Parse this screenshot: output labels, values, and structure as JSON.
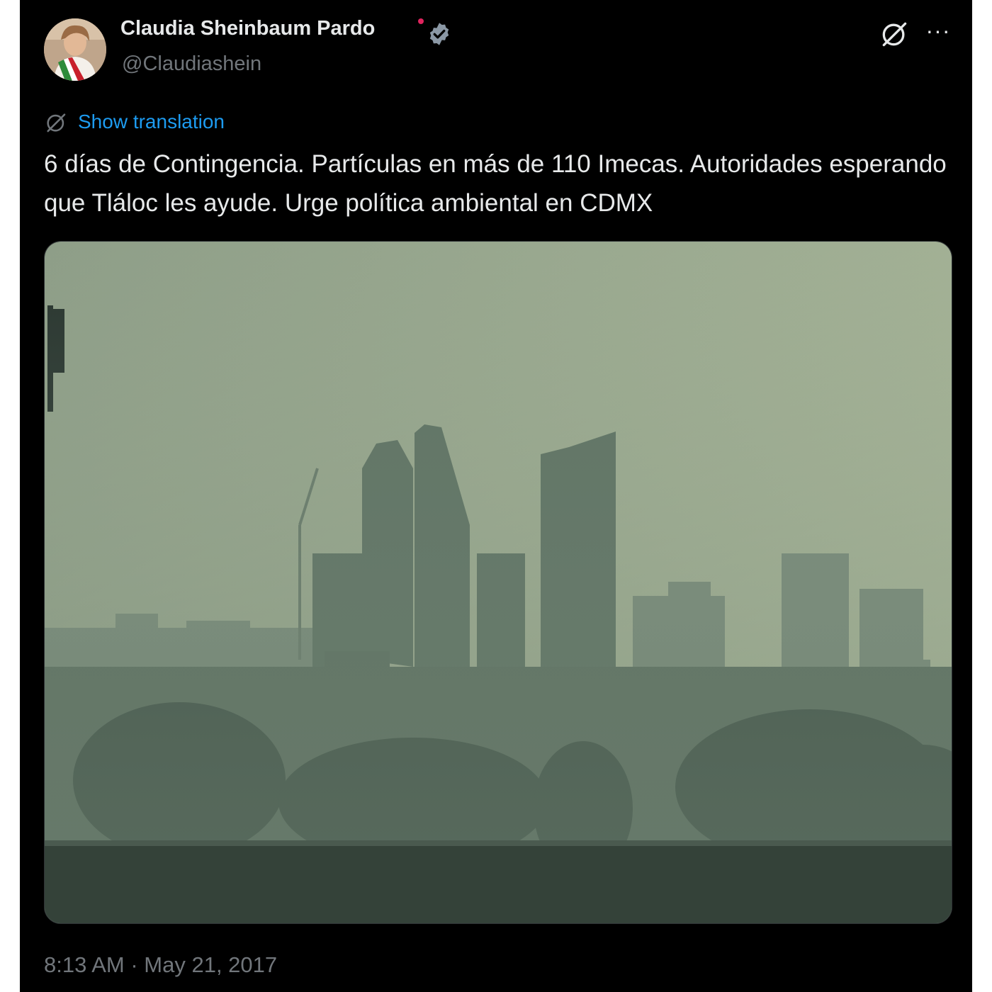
{
  "author": {
    "display_name": "Claudia Sheinbaum Pardo",
    "handle": "@Claudiashein",
    "verified_icon": "verified-badge-icon"
  },
  "actions": {
    "grok_icon": "grok-icon",
    "more_icon": "more-icon",
    "more_label": "···"
  },
  "translation": {
    "icon": "grok-translate-icon",
    "label": "Show translation"
  },
  "tweet": {
    "text": "6 días de Contingencia. Partículas en más de 110 Imecas. Autoridades esperando que Tláloc les ayude. Urge política ambiental en CDMX",
    "timestamp": "8:13 AM · May 21, 2017"
  },
  "colors": {
    "background": "#000000",
    "text_primary": "#e7e9ea",
    "text_secondary": "#71767b",
    "link": "#1d9bf0",
    "verified": "#8b98a5"
  }
}
